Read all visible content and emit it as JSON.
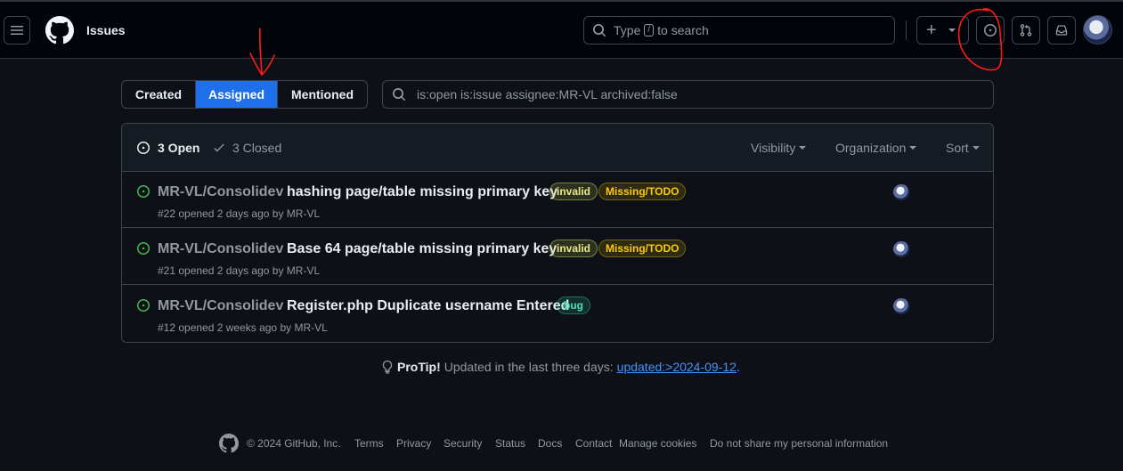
{
  "header": {
    "context": "Issues",
    "search_placeholder_pre": "Type",
    "search_key": "/",
    "search_placeholder_post": "to search",
    "new_button": "+"
  },
  "filters": {
    "tabs": [
      "Created",
      "Assigned",
      "Mentioned"
    ],
    "active_tab": "Assigned",
    "query": "is:open is:issue assignee:MR-VL archived:false"
  },
  "box": {
    "open_label": "3 Open",
    "closed_label": "3 Closed",
    "menus": [
      "Visibility",
      "Organization",
      "Sort"
    ]
  },
  "issues": [
    {
      "repo": "MR-VL/Consolidev",
      "title": "hashing page/table missing primary key",
      "labels": [
        "invalid",
        "Missing/TODO"
      ],
      "meta": "#22 opened 2 days ago by MR-VL"
    },
    {
      "repo": "MR-VL/Consolidev",
      "title": "Base 64 page/table missing primary key",
      "labels": [
        "invalid",
        "Missing/TODO"
      ],
      "meta": "#21 opened 2 days ago by MR-VL"
    },
    {
      "repo": "MR-VL/Consolidev",
      "title": "Register.php Duplicate username Entered",
      "labels": [
        "bug"
      ],
      "meta": "#12 opened 2 weeks ago by MR-VL"
    }
  ],
  "protip": {
    "strong": "ProTip!",
    "text": "Updated in the last three days:",
    "link": "updated:>2024-09-12",
    "end": "."
  },
  "footer": {
    "copyright": "© 2024 GitHub, Inc.",
    "links": [
      "Terms",
      "Privacy",
      "Security",
      "Status",
      "Docs",
      "Contact",
      "Manage cookies",
      "Do not share my personal information"
    ]
  },
  "colors": {
    "accent": "#1f6feb",
    "open_green": "#3fb950",
    "annotation_red": "#ff1a1a"
  }
}
